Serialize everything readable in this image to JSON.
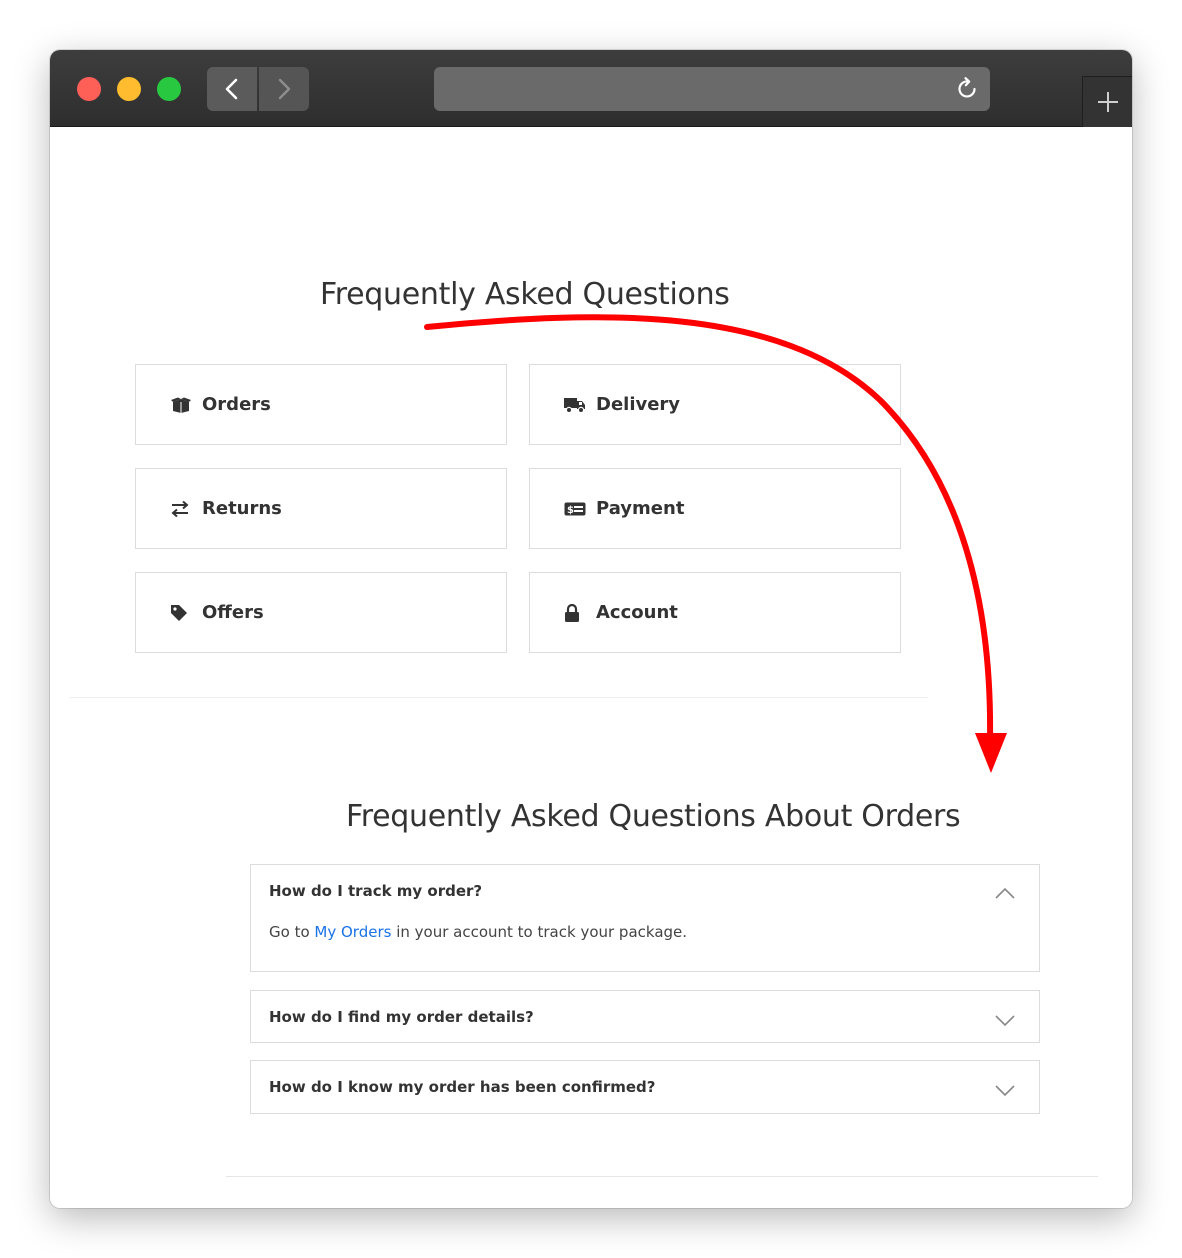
{
  "page": {
    "title": "Frequently Asked Questions",
    "section_title": "Frequently Asked Questions About Orders"
  },
  "categories": [
    {
      "label": "Orders",
      "icon": "box-open-icon"
    },
    {
      "label": "Delivery",
      "icon": "truck-icon"
    },
    {
      "label": "Returns",
      "icon": "exchange-icon"
    },
    {
      "label": "Payment",
      "icon": "money-bill-icon"
    },
    {
      "label": "Offers",
      "icon": "tag-icon"
    },
    {
      "label": "Account",
      "icon": "lock-icon"
    }
  ],
  "faqs": [
    {
      "question": "How do I track my order?",
      "expanded": true,
      "answer_before": "Go to ",
      "answer_link": "My Orders",
      "answer_after": " in your account to track your package."
    },
    {
      "question": "How do I find my order details?",
      "expanded": false
    },
    {
      "question": "How do I know my order has been confirmed?",
      "expanded": false
    }
  ],
  "colors": {
    "link": "#1a73e8",
    "annotation_arrow": "#ff0000",
    "traffic_red": "#fe5f57",
    "traffic_yellow": "#febc2e",
    "traffic_green": "#28c840"
  }
}
